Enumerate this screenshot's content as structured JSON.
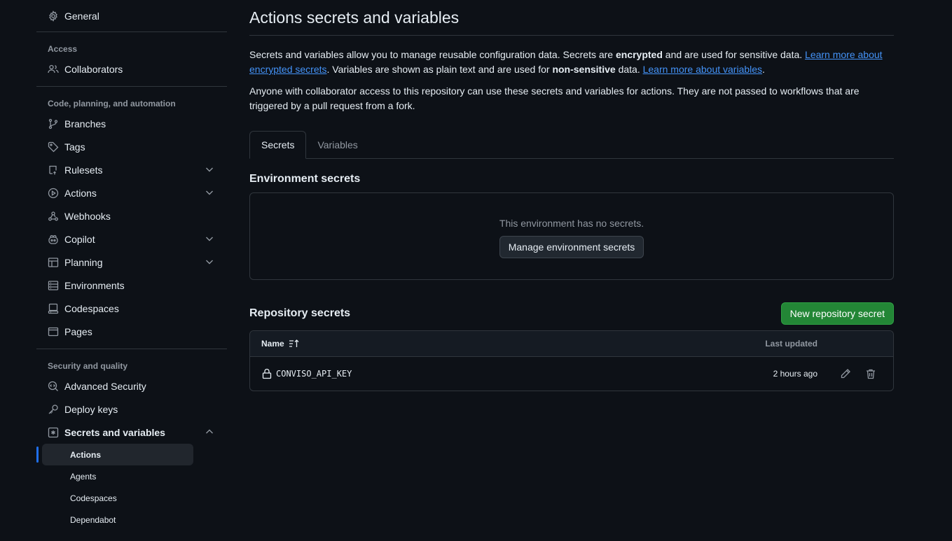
{
  "sidebar": {
    "general": "General",
    "access_title": "Access",
    "collaborators": "Collaborators",
    "code_title": "Code, planning, and automation",
    "branches": "Branches",
    "tags": "Tags",
    "rulesets": "Rulesets",
    "actions": "Actions",
    "webhooks": "Webhooks",
    "copilot": "Copilot",
    "planning": "Planning",
    "environments": "Environments",
    "codespaces": "Codespaces",
    "pages": "Pages",
    "security_title": "Security and quality",
    "advanced_security": "Advanced Security",
    "deploy_keys": "Deploy keys",
    "secrets_and_variables": "Secrets and variables",
    "sub": {
      "actions": "Actions",
      "agents": "Agents",
      "codespaces": "Codespaces",
      "dependabot": "Dependabot"
    }
  },
  "main": {
    "title": "Actions secrets and variables",
    "desc": {
      "p1": "Secrets and variables allow you to manage reusable configuration data. Secrets are ",
      "encrypted": "encrypted",
      "p2": " and are used for sensitive data. ",
      "link1": "Learn more about encrypted secrets",
      "p3": ". Variables are shown as plain text and are used for ",
      "nonsensitive": "non-sensitive",
      "p4": " data. ",
      "link2": "Learn more about variables",
      "p5": "."
    },
    "desc2": "Anyone with collaborator access to this repository can use these secrets and variables for actions. They are not passed to workflows that are triggered by a pull request from a fork.",
    "tabs": {
      "secrets": "Secrets",
      "variables": "Variables"
    },
    "env": {
      "title": "Environment secrets",
      "empty": "This environment has no secrets.",
      "manage_button": "Manage environment secrets"
    },
    "repo": {
      "title": "Repository secrets",
      "new_button": "New repository secret",
      "col_name": "Name",
      "col_updated": "Last updated",
      "rows": [
        {
          "name": "CONVISO_API_KEY",
          "updated": "2 hours ago"
        }
      ]
    }
  },
  "colors": {
    "background": "#0d1117",
    "border": "#30363d",
    "link": "#4493f8",
    "green_button": "#238636",
    "active_indicator": "#1f6feb"
  }
}
